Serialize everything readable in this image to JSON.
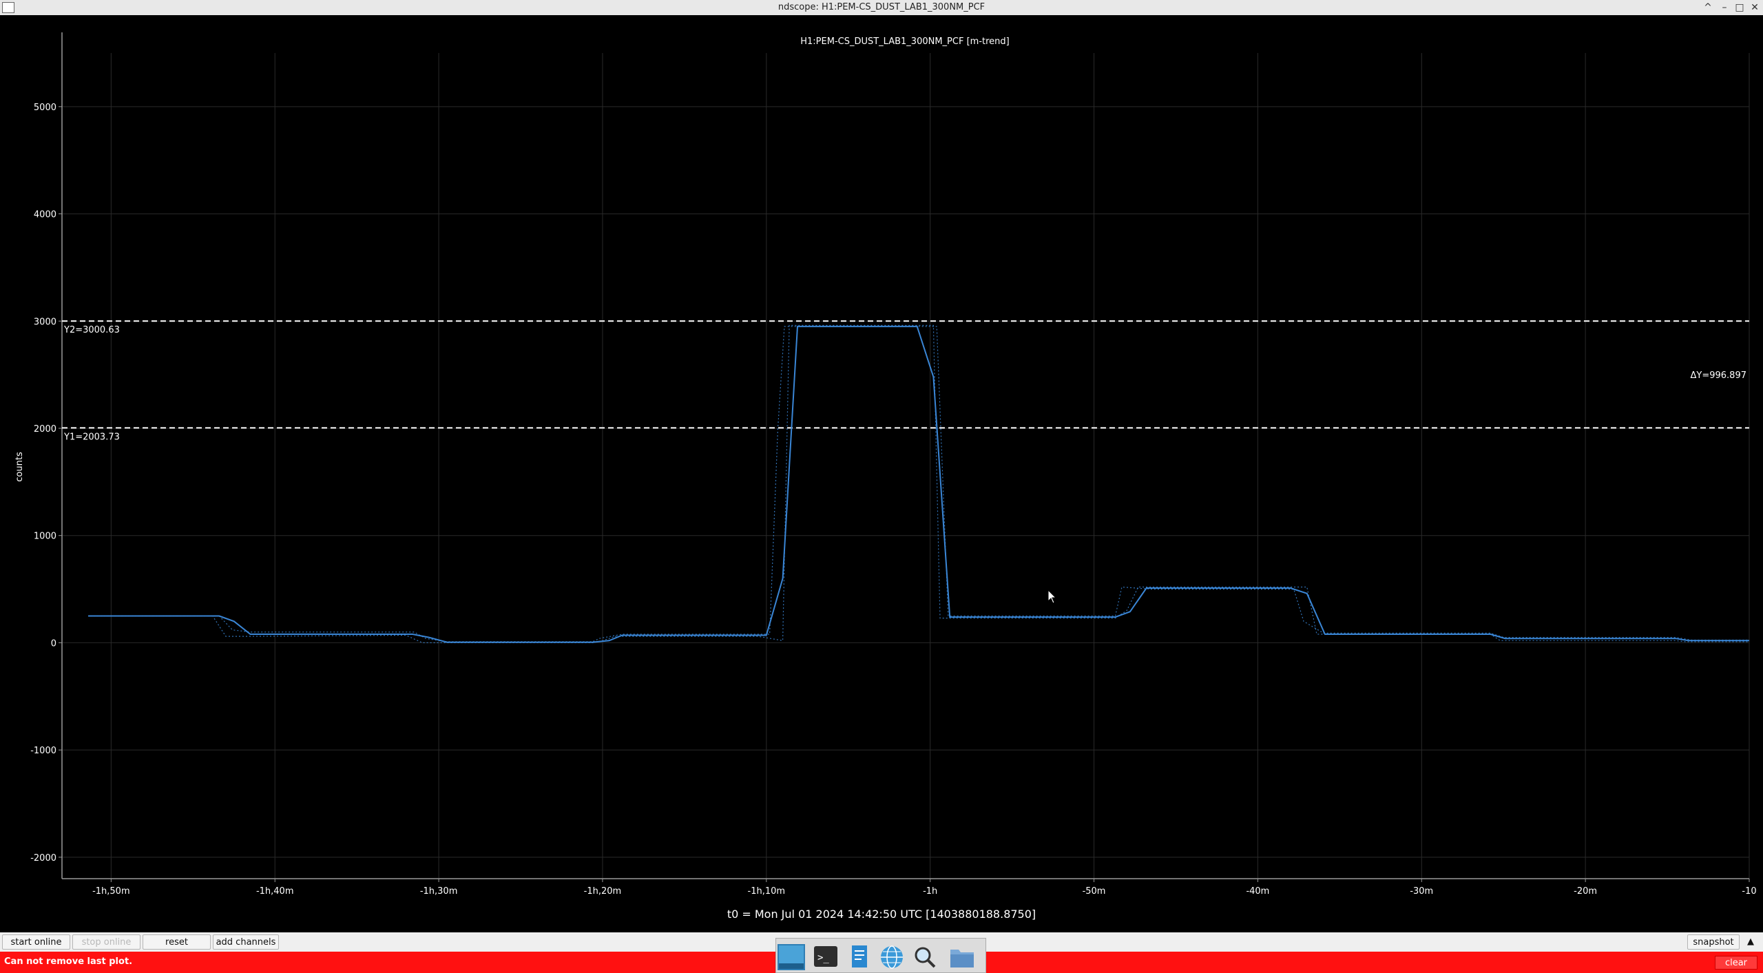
{
  "window": {
    "title": "ndscope: H1:PEM-CS_DUST_LAB1_300NM_PCF",
    "buttons": [
      "^",
      "–",
      "□",
      "✕"
    ]
  },
  "plot": {
    "title": "H1:PEM-CS_DUST_LAB1_300NM_PCF [m-trend]",
    "ylabel": "counts",
    "t0_label": "t0 = Mon Jul 01 2024 14:42:50 UTC [1403880188.8750]",
    "cursor_y1": "Y1=2003.73",
    "cursor_y2": "Y2=3000.63",
    "cursor_dy": "ΔY=996.897",
    "colors": {
      "background": "#000000",
      "line": "#3a86d6",
      "grid": "#2a2a2a",
      "cursor": "#ffffff"
    }
  },
  "chart_data": {
    "type": "line",
    "title": "H1:PEM-CS_DUST_LAB1_300NM_PCF [m-trend]",
    "xlabel": "",
    "ylabel": "counts",
    "xlim": [
      -113,
      -10
    ],
    "ylim": [
      -2200,
      5500
    ],
    "x_ticks": [
      -110,
      -100,
      -90,
      -80,
      -70,
      -60,
      -50,
      -40,
      -30,
      -20,
      -10
    ],
    "x_tick_labels": [
      "-1h,50m",
      "-1h,40m",
      "-1h,30m",
      "-1h,20m",
      "-1h,10m",
      "-1h",
      "-50m",
      "-40m",
      "-30m",
      "-20m",
      "-10"
    ],
    "y_ticks": [
      -2000,
      -1000,
      0,
      1000,
      2000,
      3000,
      4000,
      5000
    ],
    "y_tick_labels": [
      "-2000",
      "-1000",
      "0",
      "1000",
      "2000",
      "3000",
      "4000",
      "5000"
    ],
    "grid": true,
    "cursors": {
      "y1": 2003.73,
      "y2": 3000.63,
      "dy": 996.897
    },
    "series": [
      {
        "style": "solid",
        "x": [
          -111.4,
          -103.4,
          -102.5,
          -101.5,
          -91.6,
          -90.6,
          -89.5,
          -80.6,
          -79.6,
          -78.8,
          -70.0,
          -69.0,
          -68.1,
          -60.8,
          -59.8,
          -58.8,
          -48.7,
          -47.8,
          -46.8,
          -38.0,
          -37.0,
          -35.9,
          -25.8,
          -24.9,
          -14.5,
          -13.7,
          -10.0
        ],
        "y": [
          250,
          250,
          200,
          80,
          80,
          50,
          5,
          5,
          20,
          70,
          70,
          600,
          2950,
          2950,
          2480,
          240,
          240,
          290,
          510,
          510,
          460,
          80,
          80,
          40,
          40,
          20,
          20
        ]
      },
      {
        "style": "dotted",
        "x": [
          -111.4,
          -103.8,
          -103.0,
          -101.5,
          -92.0,
          -91.0,
          -89.5,
          -80.6,
          -80.0,
          -79.2,
          -70.5,
          -69.0,
          -68.6,
          -60.4,
          -59.8,
          -59.4,
          -48.7,
          -48.0,
          -47.3,
          -37.5,
          -37.0,
          -36.4,
          -25.8,
          -25.2,
          -14.5,
          -13.9,
          -10.0
        ],
        "y": [
          250,
          250,
          60,
          60,
          70,
          0,
          0,
          0,
          20,
          60,
          60,
          20,
          2960,
          2960,
          2960,
          230,
          230,
          300,
          520,
          520,
          520,
          80,
          80,
          20,
          20,
          10,
          10
        ]
      },
      {
        "style": "dotted",
        "x": [
          -111.4,
          -103.4,
          -102.6,
          -101.5,
          -91.5,
          -90.8,
          -89.5,
          -80.6,
          -80.2,
          -78.8,
          -69.8,
          -69.3,
          -68.9,
          -60.6,
          -59.6,
          -58.9,
          -48.7,
          -48.3,
          -46.5,
          -37.8,
          -37.2,
          -36.0,
          -25.8,
          -25.0,
          -14.5,
          -13.5,
          -10.0
        ],
        "y": [
          250,
          250,
          120,
          100,
          100,
          40,
          10,
          10,
          40,
          80,
          80,
          2000,
          2950,
          2950,
          2950,
          250,
          250,
          520,
          500,
          500,
          200,
          90,
          90,
          50,
          50,
          25,
          25
        ]
      }
    ]
  },
  "toolbar": {
    "start_online": "start online",
    "stop_online": "stop online",
    "reset": "reset",
    "add_channels": "add channels",
    "snapshot": "snapshot",
    "expand": "▲"
  },
  "status": {
    "message": "Can not remove last plot.",
    "clear": "clear"
  },
  "taskbar": {
    "icons": [
      "desktop-icon",
      "terminal-icon",
      "text-editor-icon",
      "browser-globe-icon",
      "search-icon",
      "file-manager-icon"
    ]
  }
}
